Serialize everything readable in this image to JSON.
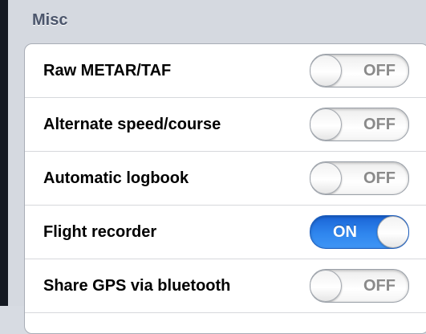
{
  "section": {
    "title": "Misc"
  },
  "settings": [
    {
      "label": "Raw METAR/TAF",
      "state": "OFF"
    },
    {
      "label": "Alternate speed/course",
      "state": "OFF"
    },
    {
      "label": "Automatic logbook",
      "state": "OFF"
    },
    {
      "label": "Flight recorder",
      "state": "ON"
    },
    {
      "label": "Share GPS via bluetooth",
      "state": "OFF"
    }
  ],
  "colors": {
    "toggle_on": "#2a7be6",
    "section_header": "#4c566c"
  }
}
